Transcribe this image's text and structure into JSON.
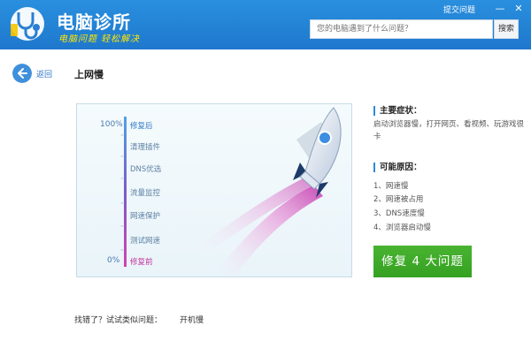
{
  "header": {
    "title": "电脑诊所",
    "slogan": "电脑问题 轻松解决",
    "feedback_label": "提交问题",
    "minimize_glyph": "—",
    "close_glyph": "✕",
    "search": {
      "placeholder": "您的电脑遇到了什么问题？",
      "button_label": "搜索"
    }
  },
  "nav": {
    "back_label": "返回"
  },
  "page": {
    "title": "上网慢"
  },
  "progress": {
    "top_percent": "100%",
    "bottom_percent": "0%",
    "steps": [
      "修复后",
      "清理插件",
      "DNS优选",
      "流量监控",
      "网速保护",
      "测试网速",
      "修复前"
    ],
    "arrow_glyph": "⌃"
  },
  "symptoms": {
    "title": "主要症状：",
    "text": "启动浏览器慢，打开网页、看视频、玩游戏很卡"
  },
  "causes": {
    "title": "可能原因：",
    "items": [
      "1、网速慢",
      "2、网速被占用",
      "3、DNS速度慢",
      "4、浏览器启动慢"
    ]
  },
  "repair_button": "修复 4 大问题",
  "footer": {
    "hint": "找错了？试试类似问题：",
    "related_link": "开机慢"
  },
  "colors": {
    "header_blue": "#1e78cd",
    "accent_blue": "#2d8ad8",
    "repair_green": "#3aa626",
    "slogan_yellow": "#ffe600"
  }
}
